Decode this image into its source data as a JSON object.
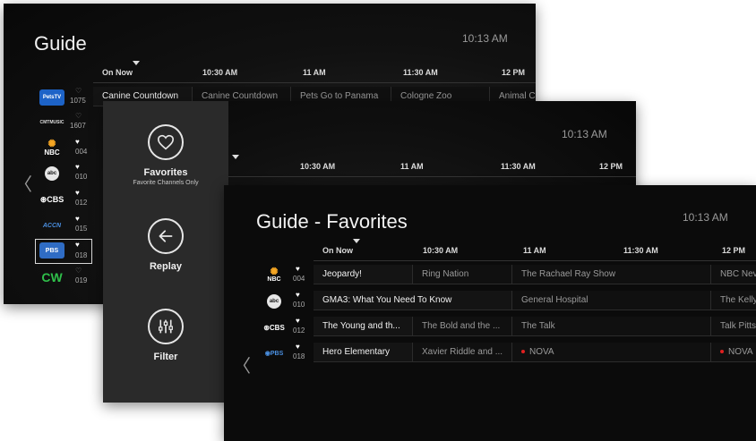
{
  "screen1": {
    "title": "Guide",
    "clock": "10:13 AM",
    "times": [
      "On Now",
      "10:30 AM",
      "11 AM",
      "11:30 AM",
      "12 PM"
    ],
    "channels": [
      {
        "logo": "PetsTV",
        "num": "1075"
      },
      {
        "logo": "CMTMUSIC",
        "num": "1607"
      },
      {
        "logo": "NBC",
        "num": "004"
      },
      {
        "logo": "abc",
        "num": "010"
      },
      {
        "logo": "CBS",
        "num": "012"
      },
      {
        "logo": "ACCN",
        "num": "015"
      },
      {
        "logo": "PBS",
        "num": "018"
      },
      {
        "logo": "CW",
        "num": "019"
      }
    ],
    "programs": [
      "Canine Countdown",
      "Canine Countdown",
      "Pets Go to Panama",
      "Cologne Zoo",
      "Animal C"
    ]
  },
  "screen2": {
    "clock": "10:13 AM",
    "times": [
      "10:30 AM",
      "11 AM",
      "11:30 AM",
      "12 PM"
    ],
    "menu": {
      "favorites": {
        "label": "Favorites",
        "sub": "Favorite Channels Only",
        "icon": "heart-icon"
      },
      "replay": {
        "label": "Replay",
        "icon": "arrow-left-icon"
      },
      "filter": {
        "label": "Filter",
        "icon": "sliders-icon"
      }
    }
  },
  "screen3": {
    "title": "Guide - Favorites",
    "clock": "10:13 AM",
    "times": [
      "On Now",
      "10:30 AM",
      "11 AM",
      "11:30 AM",
      "12 PM"
    ],
    "rows": [
      {
        "logo": "NBC",
        "num": "004",
        "programs": [
          "Jeopardy!",
          "Ring Nation",
          "The Rachael Ray Show",
          "NBC Nev"
        ]
      },
      {
        "logo": "abc",
        "num": "010",
        "programs": [
          "GMA3: What You Need To Know",
          "General Hospital",
          "The Kelly"
        ]
      },
      {
        "logo": "CBS",
        "num": "012",
        "programs": [
          "The Young and th...",
          "The Bold and the ...",
          "The Talk",
          "Talk Pitts"
        ]
      },
      {
        "logo": "PBS",
        "num": "018",
        "programs": [
          "Hero Elementary",
          "Xavier Riddle and ...",
          "NOVA",
          "NOVA"
        ]
      }
    ]
  },
  "colors": {
    "accent_red": "#e02020",
    "nbc_peacock": "#f5a623"
  }
}
